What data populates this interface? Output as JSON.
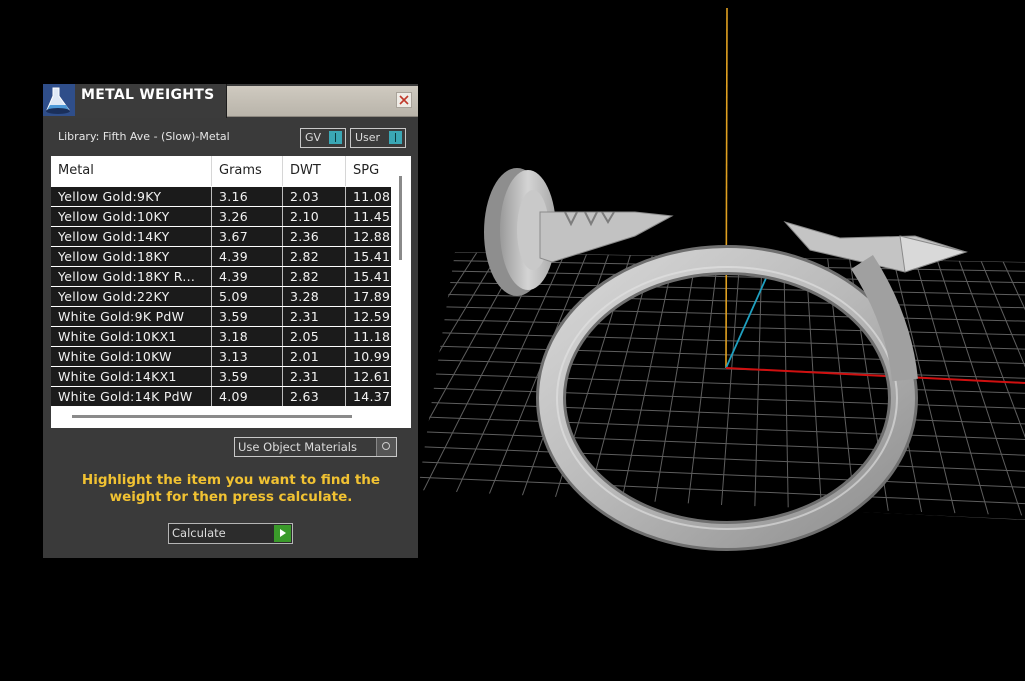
{
  "panel": {
    "title": "METAL WEIGHTS",
    "library_label": "Library: Fifth Ave - (Slow)-Metal",
    "toggles": [
      {
        "label": "GV",
        "accent": "#3aa7b5"
      },
      {
        "label": "User",
        "accent": "#3aa7b5"
      }
    ],
    "table": {
      "headers": [
        "Metal",
        "Grams",
        "DWT",
        "SPG"
      ],
      "rows": [
        [
          "Yellow Gold:9KY",
          "3.16",
          "2.03",
          "11.08"
        ],
        [
          "Yellow Gold:10KY",
          "3.26",
          "2.10",
          "11.45"
        ],
        [
          "Yellow Gold:14KY",
          "3.67",
          "2.36",
          "12.88"
        ],
        [
          "Yellow Gold:18KY",
          "4.39",
          "2.82",
          "15.41"
        ],
        [
          "Yellow Gold:18KY R...",
          "4.39",
          "2.82",
          "15.41"
        ],
        [
          "Yellow Gold:22KY",
          "5.09",
          "3.28",
          "17.89"
        ],
        [
          "White Gold:9K PdW",
          "3.59",
          "2.31",
          "12.59"
        ],
        [
          "White Gold:10KX1",
          "3.18",
          "2.05",
          "11.18"
        ],
        [
          "White Gold:10KW",
          "3.13",
          "2.01",
          "10.99"
        ],
        [
          "White Gold:14KX1",
          "3.59",
          "2.31",
          "12.61"
        ],
        [
          "White Gold:14K PdW",
          "4.09",
          "2.63",
          "14.37"
        ]
      ]
    },
    "use_object_materials_label": "Use Object Materials",
    "instructions": "Highlight the item you want to find the weight for then press calculate.",
    "calculate_label": "Calculate"
  },
  "colors": {
    "panel_bg": "#3a3a3a",
    "instruction_text": "#f1c232",
    "calculate_go": "#3a9a2a",
    "axis_x": "#d01010",
    "axis_y": "#1fa0c0",
    "axis_z": "#e0a020",
    "ring_metal": "#b9b9b9"
  }
}
